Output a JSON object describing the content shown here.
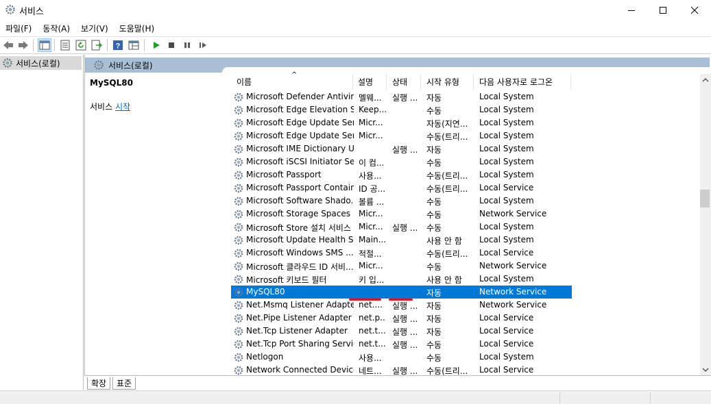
{
  "window": {
    "title": "서비스"
  },
  "menu": [
    "파일(F)",
    "동작(A)",
    "보기(V)",
    "도움말(H)"
  ],
  "tree": {
    "item_label": "서비스(로컬)"
  },
  "main": {
    "header_label": "서비스(로컬)",
    "selected_service": "MySQL80",
    "action_prefix": "서비스 ",
    "action_link": "시작"
  },
  "columns": [
    "이름",
    "설명",
    "상태",
    "시작 유형",
    "다음 사용자로 로그온"
  ],
  "rows": [
    {
      "name": "Microsoft Defender Antivir...",
      "desc": "멜웨...",
      "status": "실행 ...",
      "startup": "자동",
      "logon": "Local System"
    },
    {
      "name": "Microsoft Edge Elevation S...",
      "desc": "Keep...",
      "status": "",
      "startup": "수동",
      "logon": "Local System"
    },
    {
      "name": "Microsoft Edge Update Ser...",
      "desc": "Micr...",
      "status": "",
      "startup": "자동(지연...",
      "logon": "Local System"
    },
    {
      "name": "Microsoft Edge Update Ser...",
      "desc": "Micr...",
      "status": "",
      "startup": "수동(트리...",
      "logon": "Local System"
    },
    {
      "name": "Microsoft IME Dictionary U...",
      "desc": "",
      "status": "실행 ...",
      "startup": "자동",
      "logon": "Local System"
    },
    {
      "name": "Microsoft iSCSI Initiator Se...",
      "desc": "이 컴...",
      "status": "",
      "startup": "수동",
      "logon": "Local System"
    },
    {
      "name": "Microsoft Passport",
      "desc": "사용...",
      "status": "",
      "startup": "수동(트리...",
      "logon": "Local System"
    },
    {
      "name": "Microsoft Passport Container",
      "desc": "ID 공...",
      "status": "",
      "startup": "수동(트리...",
      "logon": "Local Service"
    },
    {
      "name": "Microsoft Software Shado...",
      "desc": "볼륨 ...",
      "status": "",
      "startup": "수동",
      "logon": "Local System"
    },
    {
      "name": "Microsoft Storage Spaces ...",
      "desc": "Micr...",
      "status": "",
      "startup": "수동",
      "logon": "Network Service"
    },
    {
      "name": "Microsoft Store 설치 서비스",
      "desc": "Micr...",
      "status": "실행 ...",
      "startup": "수동",
      "logon": "Local System"
    },
    {
      "name": "Microsoft Update Health S...",
      "desc": "Main...",
      "status": "",
      "startup": "사용 안 함",
      "logon": "Local System"
    },
    {
      "name": "Microsoft Windows SMS ...",
      "desc": "적절...",
      "status": "",
      "startup": "수동(트리...",
      "logon": "Local Service"
    },
    {
      "name": "Microsoft 클라우드 ID 서비...",
      "desc": "Micr...",
      "status": "",
      "startup": "수동",
      "logon": "Network Service"
    },
    {
      "name": "Microsoft 키보드 필터",
      "desc": "키 입...",
      "status": "",
      "startup": "사용 안 함",
      "logon": "Local System"
    },
    {
      "name": "MySQL80",
      "desc": "",
      "status": "",
      "startup": "자동",
      "logon": "Network Service"
    },
    {
      "name": "Net.Msmq Listener Adapter",
      "desc": "net....",
      "status": "실행 ...",
      "startup": "자동",
      "logon": "Network Service"
    },
    {
      "name": "Net.Pipe Listener Adapter",
      "desc": "net.p...",
      "status": "실행 ...",
      "startup": "자동",
      "logon": "Local Service"
    },
    {
      "name": "Net.Tcp Listener Adapter",
      "desc": "net.t...",
      "status": "실행 ...",
      "startup": "자동",
      "logon": "Local Service"
    },
    {
      "name": "Net.Tcp Port Sharing Service",
      "desc": "net.t...",
      "status": "실행 ...",
      "startup": "수동",
      "logon": "Local Service"
    },
    {
      "name": "Netlogon",
      "desc": "사용...",
      "status": "",
      "startup": "수동",
      "logon": "Local System"
    },
    {
      "name": "Network Connected Device...",
      "desc": "네트...",
      "status": "실행 ...",
      "startup": "수동(트리...",
      "logon": "Local Service"
    }
  ],
  "tabs": [
    "확장",
    "표준"
  ],
  "colors": {
    "selection": "#0078d7",
    "header": "#a9bfd6",
    "link": "#0066cc",
    "annotation": "#e11111"
  }
}
